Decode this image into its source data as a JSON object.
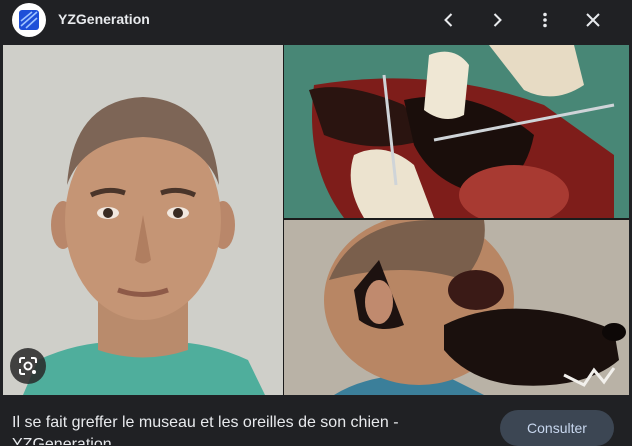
{
  "header": {
    "site_name": "YZGeneration",
    "logo_icon": "yzgeneration-logo",
    "buttons": [
      "chevron-left-icon",
      "chevron-right-icon",
      "more-vert-icon",
      "close-icon"
    ]
  },
  "media": {
    "images": [
      "portrait",
      "surgery",
      "dog-snout-head"
    ]
  },
  "caption": {
    "text": "Il se fait greffer le museau et les oreilles de son chien - YZGeneration"
  },
  "actions": {
    "consult_label": "Consulter"
  },
  "colors": {
    "background": "#202124",
    "button_bg": "#3c4653",
    "button_text": "#c8d7ee"
  }
}
